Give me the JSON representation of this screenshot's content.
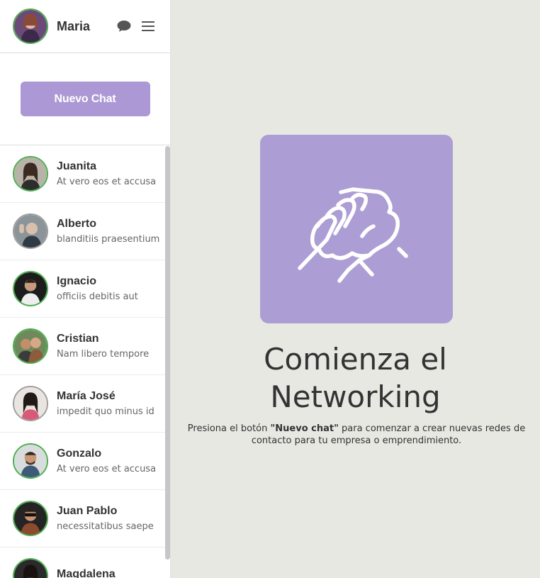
{
  "user": {
    "name": "Maria"
  },
  "new_chat_label": "Nuevo Chat",
  "chats": [
    {
      "name": "Juanita",
      "message": "At vero eos et accusa"
    },
    {
      "name": "Alberto",
      "message": "blanditiis praesentium"
    },
    {
      "name": "Ignacio",
      "message": "officiis debitis aut"
    },
    {
      "name": "Cristian",
      "message": "Nam libero tempore"
    },
    {
      "name": "María José",
      "message": "impedit quo minus id"
    },
    {
      "name": "Gonzalo",
      "message": "At vero eos et accusa"
    },
    {
      "name": "Juan Pablo",
      "message": "necessitatibus saepe"
    },
    {
      "name": "Magdalena",
      "message": ""
    }
  ],
  "main": {
    "title_line1": "Comienza el",
    "title_line2": "Networking",
    "desc_prefix": "Presiona el botón ",
    "desc_bold": "\"Nuevo chat\"",
    "desc_suffix": " para comenzar a crear nuevas redes de contacto para tu empresa o emprendimiento."
  },
  "colors": {
    "accent": "#ab98d4",
    "online": "#4caf50",
    "main_bg": "#e7e8e2"
  },
  "icons": {
    "chat": "chat-bubble-icon",
    "menu": "hamburger-menu-icon",
    "hero": "handshake-icon"
  }
}
